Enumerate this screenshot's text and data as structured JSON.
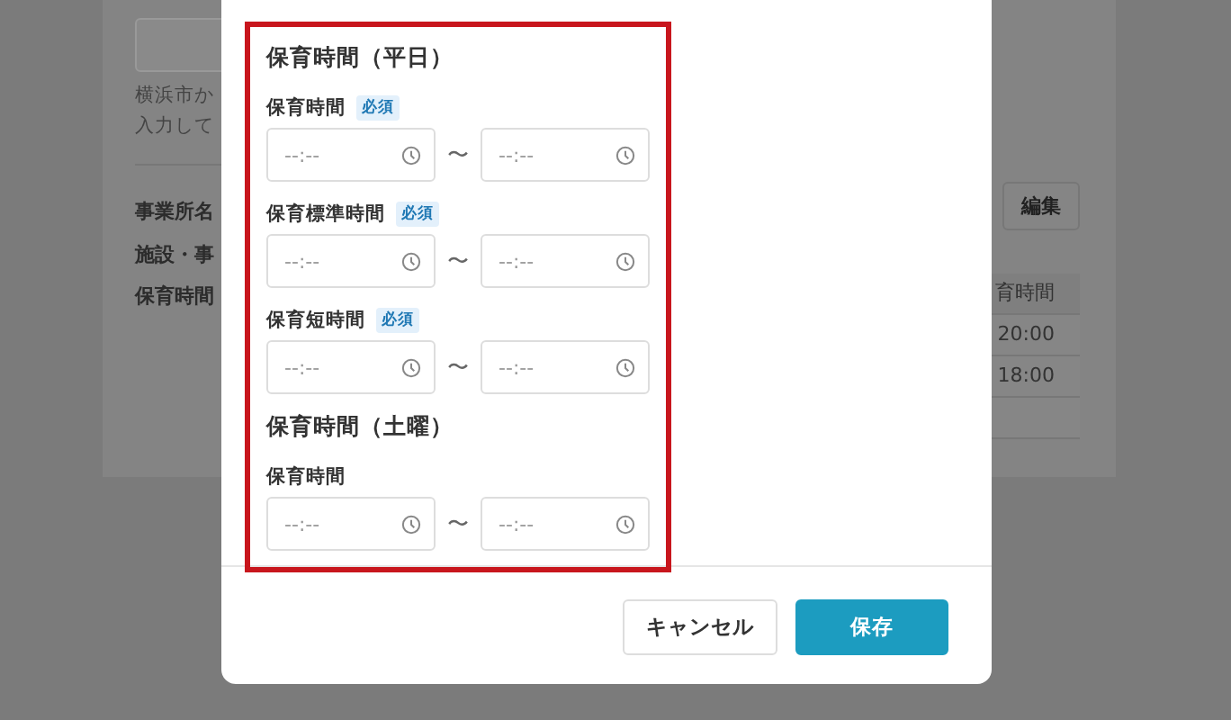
{
  "background": {
    "notes": [
      "横浜市か",
      "入力して"
    ],
    "rows": [
      {
        "label": "事業所名"
      },
      {
        "label": "施設・事"
      },
      {
        "label": "保育時間"
      }
    ],
    "edit_button": "編集",
    "table": {
      "header": "育時間",
      "rows": [
        "20:00",
        "18:00"
      ]
    }
  },
  "modal": {
    "sections": [
      {
        "title": "保育時間（平日）",
        "fields": [
          {
            "label": "保育時間",
            "badge": "必須",
            "from": {
              "placeholder": "--:--"
            },
            "separator": "〜",
            "to": {
              "placeholder": "--:--"
            }
          },
          {
            "label": "保育標準時間",
            "badge": "必須",
            "from": {
              "placeholder": "--:--"
            },
            "separator": "〜",
            "to": {
              "placeholder": "--:--"
            }
          },
          {
            "label": "保育短時間",
            "badge": "必須",
            "from": {
              "placeholder": "--:--"
            },
            "separator": "〜",
            "to": {
              "placeholder": "--:--"
            }
          }
        ]
      },
      {
        "title": "保育時間（土曜）",
        "fields": [
          {
            "label": "保育時間",
            "from": {
              "placeholder": "--:--"
            },
            "separator": "〜",
            "to": {
              "placeholder": "--:--"
            }
          }
        ]
      }
    ],
    "buttons": [
      {
        "label": "キャンセル",
        "kind": "secondary"
      },
      {
        "label": "保存",
        "kind": "primary"
      }
    ]
  }
}
